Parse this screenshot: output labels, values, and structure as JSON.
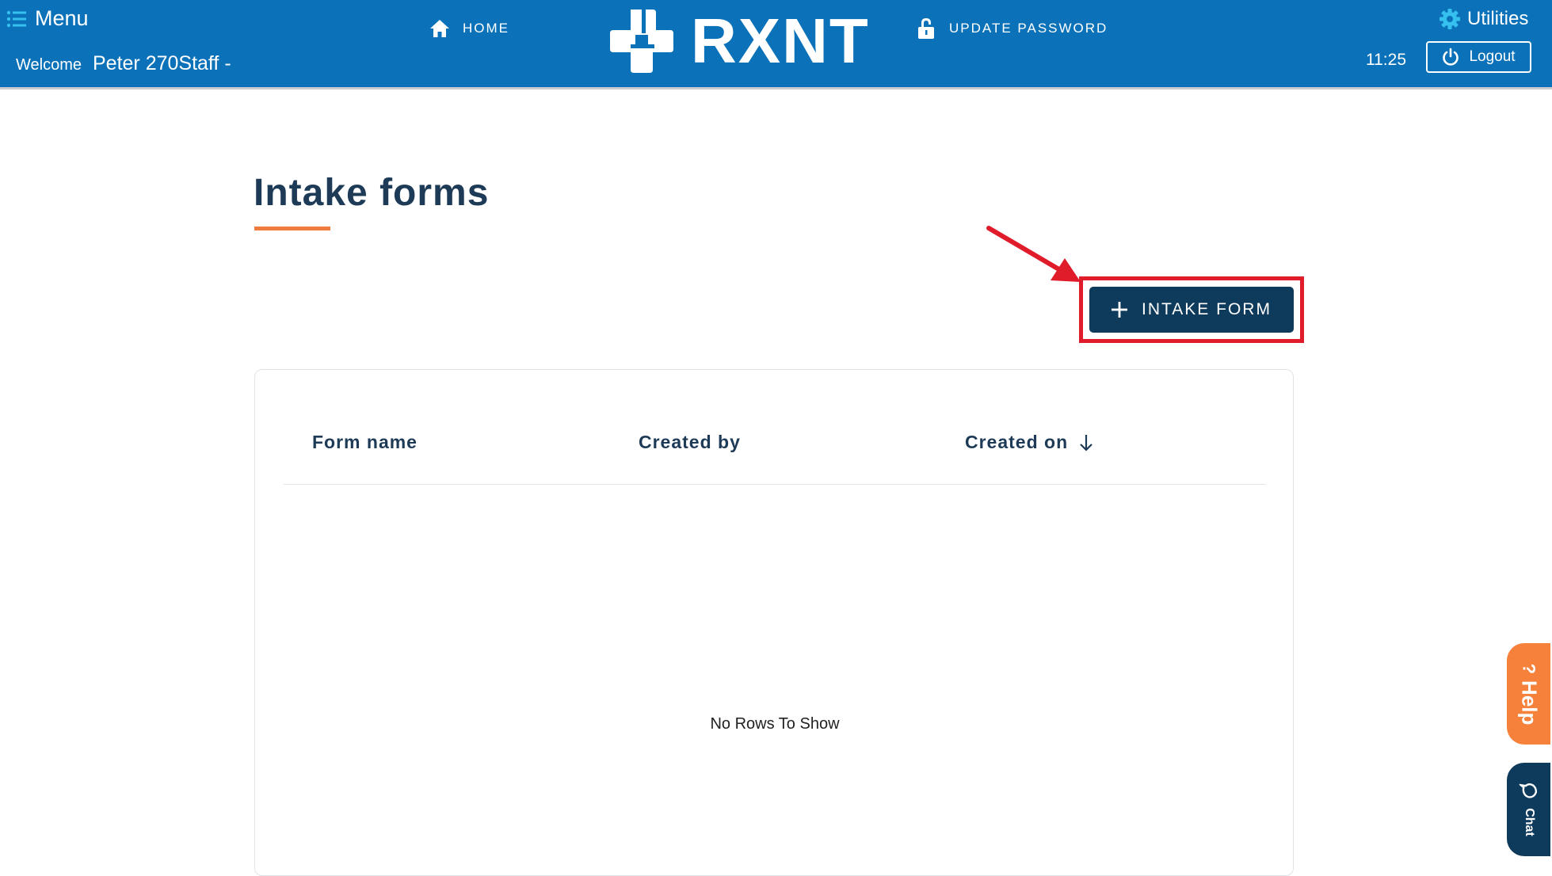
{
  "header": {
    "menu_label": "Menu",
    "welcome_label": "Welcome",
    "user_name": "Peter 270Staff -",
    "home_label": "HOME",
    "logo_text": "RXNT",
    "update_password_label": "UPDATE PASSWORD",
    "utilities_label": "Utilities",
    "clock": "11:25",
    "logout_label": "Logout"
  },
  "page": {
    "title": "Intake forms",
    "add_button_label": "INTAKE FORM"
  },
  "table": {
    "columns": [
      "Form name",
      "Created by",
      "Created on"
    ],
    "sort_column": "Created on",
    "sort_direction": "descending",
    "empty_message": "No Rows To Show"
  },
  "side_tabs": {
    "help_label": "Help",
    "help_symbol": "?",
    "chat_label": "Chat"
  },
  "colors": {
    "header_bg": "#0b72b9",
    "primary_button": "#0e3a5c",
    "accent_orange": "#f07b3f",
    "annotation_red": "#e01b2a",
    "utilities_gear": "#35c0f0"
  },
  "icons": {
    "menu": "list-icon",
    "home": "home-icon",
    "update_password": "lock-icon",
    "utilities": "gear-icon",
    "logout": "power-icon",
    "add": "plus-icon",
    "sort": "arrow-down-icon",
    "chat": "chat-bubble-icon"
  }
}
